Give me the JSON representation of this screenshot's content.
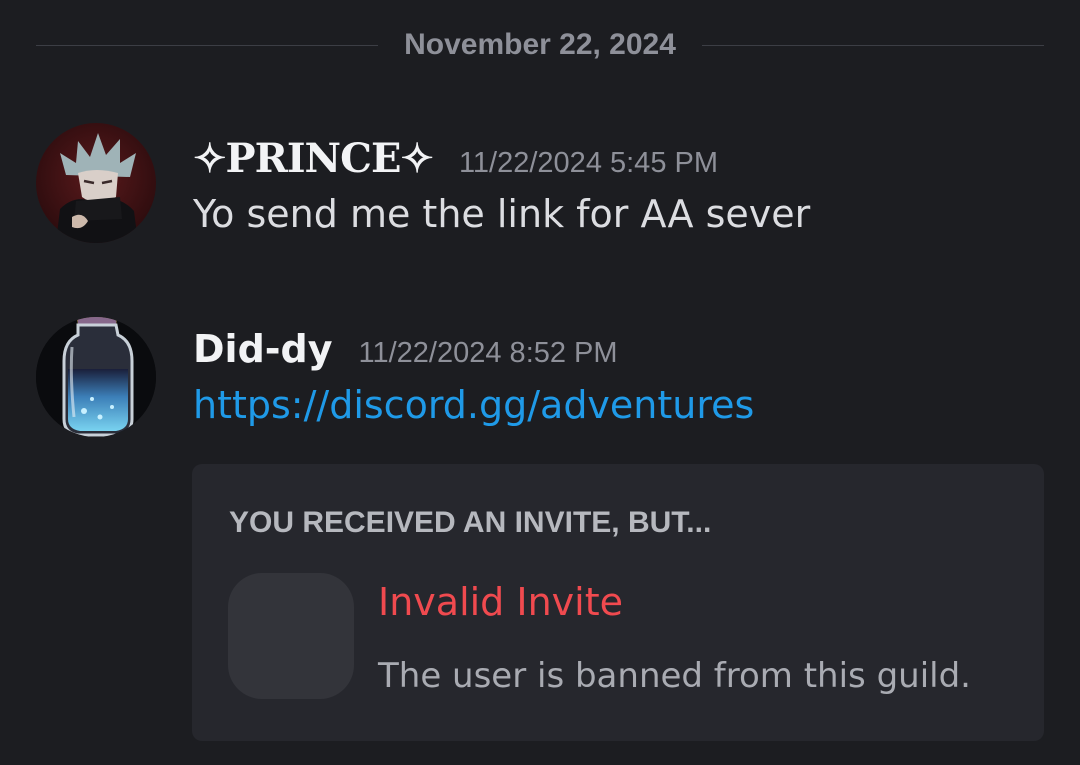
{
  "date_divider": "November 22, 2024",
  "messages": [
    {
      "username": "✧PRINCE✧",
      "timestamp": "11/22/2024 5:45 PM",
      "text": "Yo send me the link for AA sever"
    },
    {
      "username": "Did-dy",
      "timestamp": "11/22/2024 8:52 PM",
      "link": "https://discord.gg/adventures",
      "link_color": "#1f9ae8"
    }
  ],
  "invite_embed": {
    "heading": "YOU RECEIVED AN INVITE, BUT...",
    "title": "Invalid Invite",
    "title_color": "#f04a4f",
    "description": "The user is banned from this guild."
  },
  "colors": {
    "background": "#1c1d21",
    "embed_background": "#26272d",
    "muted_text": "#8e9099"
  },
  "icons": {
    "avatar_1": "anime-character-avatar",
    "avatar_2": "potion-jar-avatar",
    "guild": "guild-icon-placeholder"
  }
}
